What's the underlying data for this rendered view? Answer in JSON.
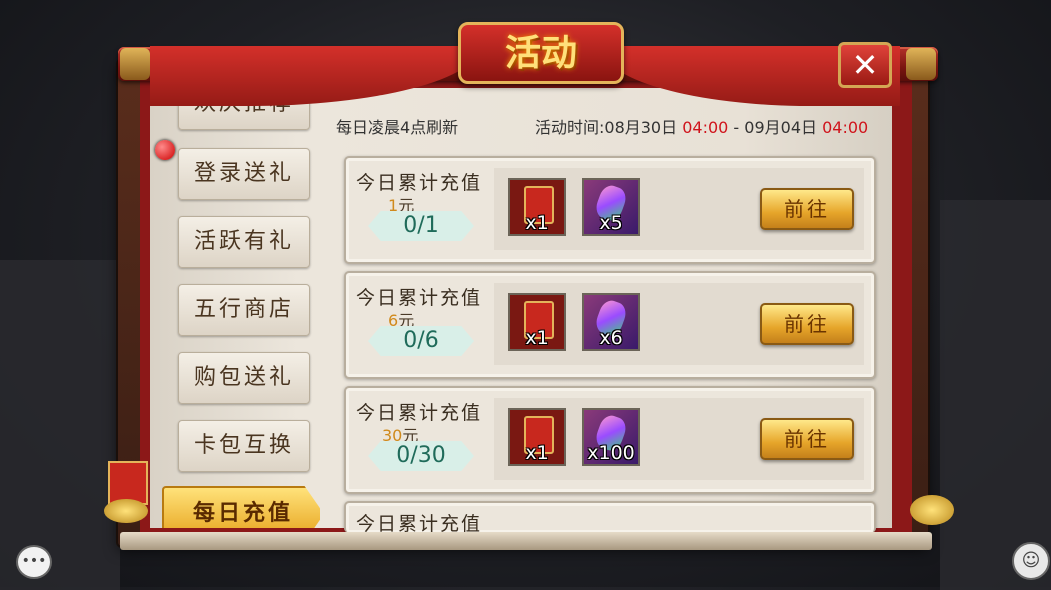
{
  "title": "活动",
  "header": {
    "refresh_note": "每日凌晨4点刷新",
    "time_prefix": "活动时间:08月30日",
    "time_start": "04:00",
    "time_sep": " - 09月04日",
    "time_end": "04:00"
  },
  "sidebar": {
    "items": [
      {
        "label": "欢庆推荐"
      },
      {
        "label": "登录送礼"
      },
      {
        "label": "活跃有礼"
      },
      {
        "label": "五行商店"
      },
      {
        "label": "购包送礼"
      },
      {
        "label": "卡包互换"
      },
      {
        "label": "每日充值"
      }
    ]
  },
  "cards": [
    {
      "title": "今日累计充值",
      "amount": "1",
      "unit": "元",
      "progress": "0/1",
      "rewards": [
        {
          "icon": "red-envelope-icon",
          "qty": "x1"
        },
        {
          "icon": "gem-icon",
          "qty": "x5"
        }
      ],
      "button": "前往"
    },
    {
      "title": "今日累计充值",
      "amount": "6",
      "unit": "元",
      "progress": "0/6",
      "rewards": [
        {
          "icon": "red-envelope-icon",
          "qty": "x1"
        },
        {
          "icon": "gem-icon",
          "qty": "x6"
        }
      ],
      "button": "前往"
    },
    {
      "title": "今日累计充值",
      "amount": "30",
      "unit": "元",
      "progress": "0/30",
      "rewards": [
        {
          "icon": "red-envelope-icon",
          "qty": "x1"
        },
        {
          "icon": "gem-icon",
          "qty": "x100"
        }
      ],
      "button": "前往"
    },
    {
      "title": "今日累计充值"
    }
  ],
  "close_label": "✕",
  "colors": {
    "accent_red": "#d0141c",
    "progress_green": "#1f6b5a",
    "amount_orange": "#d08a1c"
  }
}
